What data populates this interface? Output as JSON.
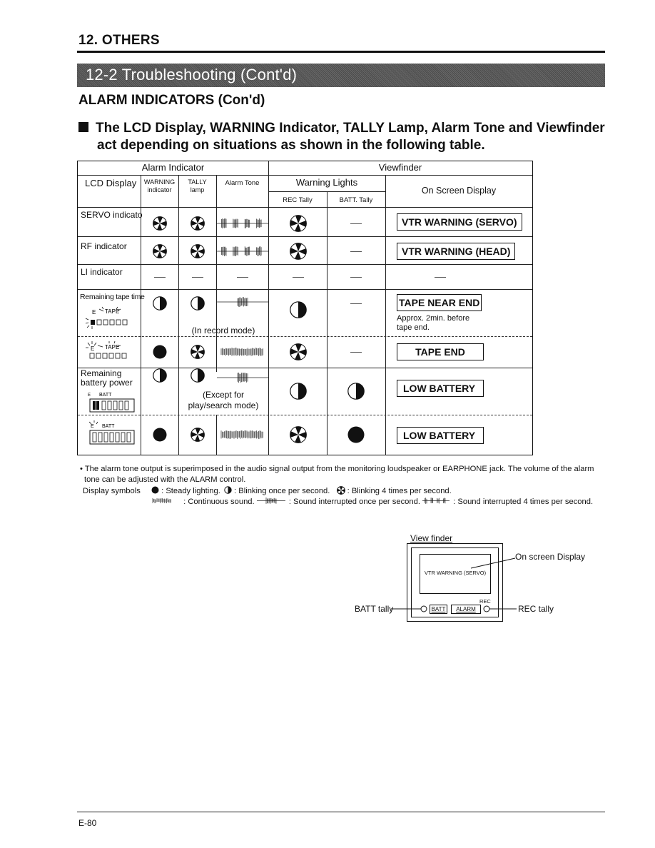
{
  "section": {
    "title": "12. OTHERS"
  },
  "banner": {
    "title": "12-2  Troubleshooting (Cont'd)"
  },
  "heading": "ALARM INDICATORS (Con'd)",
  "subheading": {
    "line1": "The LCD Display, WARNING Indicator, TALLY Lamp, Alarm Tone and Viewfinder",
    "line2": "act depending on situations as shown in the following table."
  },
  "table": {
    "group_headers": {
      "alarm_indicator": "Alarm Indicator",
      "viewfinder": "Viewfinder",
      "warning_lights": "Warning Lights"
    },
    "columns": {
      "lcd": "LCD Display",
      "warning1": "WARNING",
      "warning2": "indicator",
      "tally1": "TALLY",
      "tally2": "lamp",
      "tone": "Alarm Tone",
      "rec": "REC Tally",
      "batt": "BATT. Tally",
      "osd": "On Screen Display"
    },
    "rows": [
      {
        "lcd": "SERVO indicato",
        "warning": "blink-4",
        "tally": "blink-4",
        "tone": "interrupted-4",
        "rec": "blink-4",
        "batt": "none",
        "osd": "VTR WARNING (SERVO)"
      },
      {
        "lcd": "RF indicator",
        "warning": "blink-4",
        "tally": "blink-4",
        "tone": "interrupted-4",
        "rec": "blink-4",
        "batt": "none",
        "osd": "VTR WARNING (HEAD)"
      },
      {
        "lcd": "LI indicator",
        "warning": "none",
        "tally": "none",
        "tone": "none",
        "rec": "none",
        "batt": "none",
        "osd": "none"
      },
      {
        "lcd": "Remaining tape time",
        "lcd_icon": "tape-near-end-lcd",
        "warning": "blink-1",
        "tally": "blink-1",
        "tone": "interrupted-1",
        "tone_note": "(In record mode)",
        "rec": "blink-1",
        "batt": "none",
        "osd": "TAPE NEAR END",
        "osd_note1": "Approx. 2min. before",
        "osd_note2": "tape end."
      },
      {
        "lcd": "",
        "lcd_icon": "tape-end-lcd",
        "warning": "steady",
        "tally": "blink-4",
        "tone": "continuous",
        "rec": "blink-4",
        "batt": "none",
        "osd": "TAPE END"
      },
      {
        "lcd1": "Remaining",
        "lcd2": "battery power",
        "lcd_icon": "battery-low-lcd",
        "warning": "blink-1",
        "tally": "blink-1",
        "tone": "interrupted-1",
        "tone_note1": "(Except for",
        "tone_note2": "play/search mode)",
        "rec": "blink-1",
        "batt": "blink-1",
        "osd": "LOW BATTERY"
      },
      {
        "lcd": "",
        "lcd_icon": "battery-end-lcd",
        "warning": "steady",
        "tally": "blink-4",
        "tone": "continuous",
        "rec": "blink-4",
        "batt": "steady",
        "osd": "LOW BATTERY"
      }
    ],
    "lcd_labels": {
      "e": "E",
      "tape": "TAPE",
      "batt": "BATT"
    }
  },
  "notes": {
    "line1": "• The alarm tone output is superimposed in the audio signal output from the monitoring loudspeaker or EARPHONE jack. The volume of the alarm",
    "line2": "tone can be adjusted with the ALARM control.",
    "symbols_label": "Display symbols",
    "steady": ": Steady lighting.",
    "blink1": ": Blinking once per second.",
    "blink4": ": Blinking 4 times per second.",
    "continuous": ": Continuous sound.",
    "interrupted1": ": Sound interrupted once per second.",
    "interrupted4": ": Sound interrupted 4 times per second."
  },
  "diagram": {
    "title": "View finder",
    "screen_text": "VTR WARNING (SERVO)",
    "osd_label": "On screen Display",
    "batt_tally": "BATT tally",
    "rec_tally": "REC tally",
    "rec_small": "REC",
    "batt_btn": "BATT",
    "alarm_btn": "ALARM"
  },
  "footer": {
    "page": "E-80"
  }
}
